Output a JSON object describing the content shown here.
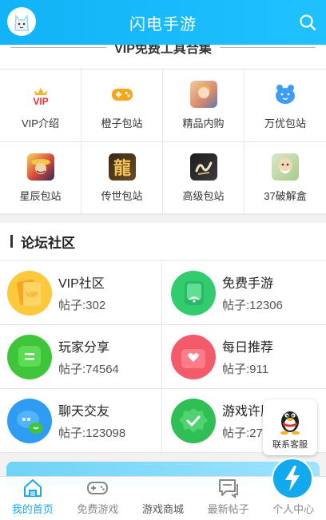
{
  "header": {
    "title": "闪电手游"
  },
  "tools": {
    "title": "VIP免费工具合集",
    "items": [
      {
        "label": "VIP介绍",
        "icon": "vip-crown-icon"
      },
      {
        "label": "橙子包站",
        "icon": "gamepad-icon"
      },
      {
        "label": "精品内购",
        "icon": "anime-girl-icon"
      },
      {
        "label": "万优包站",
        "icon": "bear-face-icon"
      },
      {
        "label": "星辰包站",
        "icon": "pirate-hero-icon"
      },
      {
        "label": "传世包站",
        "icon": "dragon-character-icon"
      },
      {
        "label": "高级包站",
        "icon": "calligraphy-logo-icon"
      },
      {
        "label": "37破解盒",
        "icon": "cartoon-monk-icon"
      }
    ]
  },
  "forum": {
    "title": "论坛社区",
    "items": [
      {
        "name": "VIP社区",
        "count": "帖子:302",
        "icon": "vip-book-icon"
      },
      {
        "name": "免费手游",
        "count": "帖子:12306",
        "icon": "phone-wifi-icon"
      },
      {
        "name": "玩家分享",
        "count": "帖子:74564",
        "icon": "share-chat-icon"
      },
      {
        "name": "每日推荐",
        "count": "帖子:911",
        "icon": "heart-box-icon"
      },
      {
        "name": "聊天交友",
        "count": "帖子:123098",
        "icon": "chat-bubbles-icon"
      },
      {
        "name": "游戏许愿",
        "count": "帖子:27",
        "icon": "badge-check-icon"
      }
    ]
  },
  "service": {
    "label": "联系客服"
  },
  "nav": {
    "tabs": [
      {
        "label": "我的首页"
      },
      {
        "label": "免费游戏"
      },
      {
        "label": "游戏商城"
      },
      {
        "label": "最新帖子"
      },
      {
        "label": "个人中心"
      }
    ]
  },
  "colors": {
    "primary": "#12b3f7",
    "active_tab": "#1aa8f0"
  }
}
